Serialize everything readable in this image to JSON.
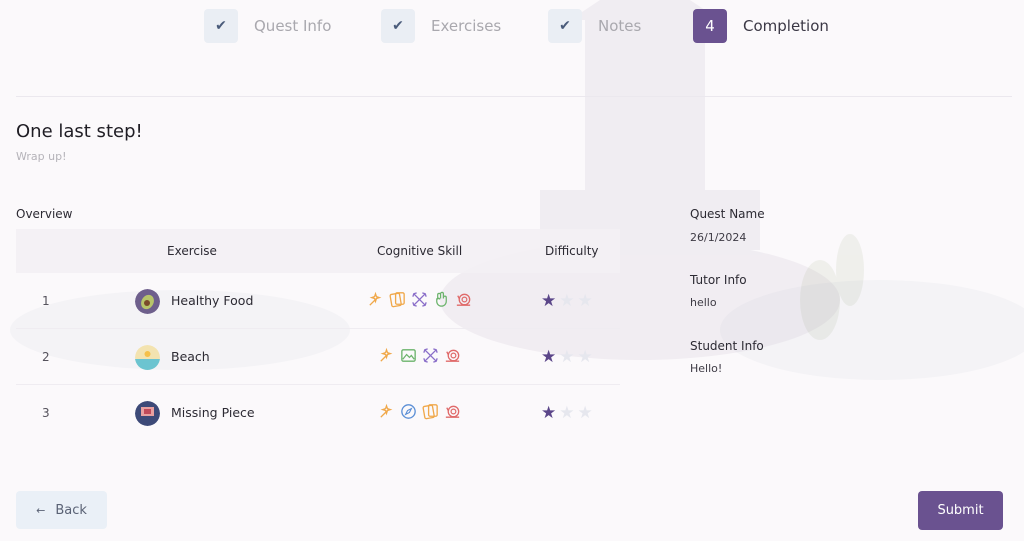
{
  "stepper": {
    "steps": [
      {
        "label": "Quest Info",
        "state": "done"
      },
      {
        "label": "Exercises",
        "state": "done"
      },
      {
        "label": "Notes",
        "state": "done"
      },
      {
        "label": "Completion",
        "state": "active",
        "number": "4"
      }
    ],
    "check_glyph": "✔"
  },
  "header": {
    "title": "One last step!",
    "subtitle": "Wrap up!"
  },
  "overview": {
    "label": "Overview",
    "columns": [
      "Exercise",
      "Cognitive Skill",
      "Difficulty"
    ],
    "rows": [
      {
        "index": "1",
        "name": "Healthy Food",
        "thumb_icon": "avocado-icon",
        "skills": [
          "sparkle-skill-icon",
          "cards-skill-icon",
          "cross-arrows-skill-icon",
          "hand-skill-icon",
          "snail-skill-icon"
        ],
        "difficulty": 1,
        "difficulty_max": 3
      },
      {
        "index": "2",
        "name": "Beach",
        "thumb_icon": "beach-icon",
        "skills": [
          "sparkle-skill-icon",
          "picture-skill-icon",
          "cross-arrows-skill-icon",
          "snail-skill-icon"
        ],
        "difficulty": 1,
        "difficulty_max": 3
      },
      {
        "index": "3",
        "name": "Missing Piece",
        "thumb_icon": "puzzle-scene-icon",
        "skills": [
          "sparkle-skill-icon",
          "compass-skill-icon",
          "cards-skill-icon",
          "snail-skill-icon"
        ],
        "difficulty": 1,
        "difficulty_max": 3
      }
    ]
  },
  "info": {
    "quest_name_label": "Quest Name",
    "quest_name_value": "26/1/2024",
    "tutor_label": "Tutor Info",
    "tutor_value": "hello",
    "student_label": "Student Info",
    "student_value": "Hello!"
  },
  "actions": {
    "back_label": "Back",
    "back_icon": "arrow-left-icon",
    "submit_label": "Submit"
  },
  "colors": {
    "accent": "#6a5290",
    "star_on": "#5b4689",
    "star_off": "#e6e7ee",
    "skill_orange": "#f0a84a",
    "skill_purple": "#8a6ec9",
    "skill_green": "#6bb36b",
    "skill_red": "#e06a6a",
    "skill_blue": "#5b8fd6"
  }
}
